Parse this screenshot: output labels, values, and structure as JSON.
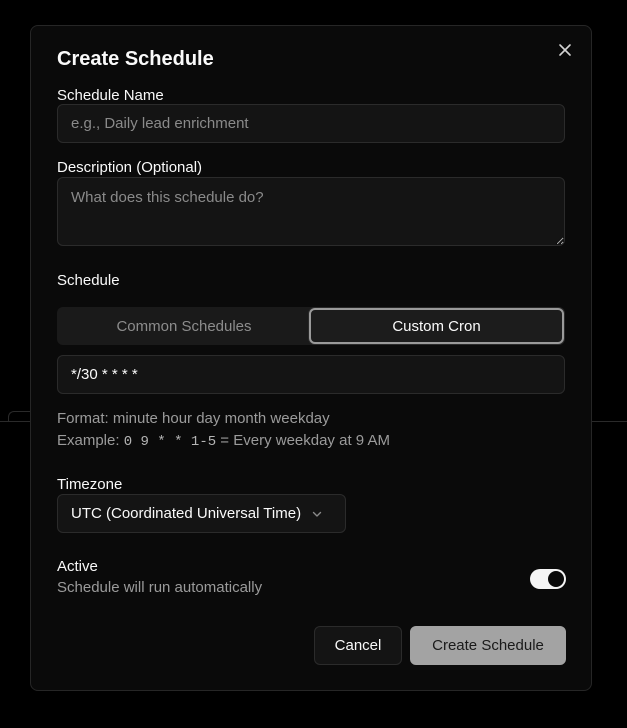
{
  "dialog": {
    "title": "Create Schedule"
  },
  "name_field": {
    "label": "Schedule Name",
    "value": "",
    "placeholder": "e.g., Daily lead enrichment"
  },
  "description_field": {
    "label": "Description (Optional)",
    "value": "",
    "placeholder": "What does this schedule do?"
  },
  "schedule": {
    "label": "Schedule",
    "tabs": [
      {
        "label": "Common Schedules",
        "active": false
      },
      {
        "label": "Custom Cron",
        "active": true
      }
    ],
    "cron_value": "*/30 * * * *",
    "format_text": "Format: minute hour day month weekday",
    "example_prefix": "Example:",
    "example_code": "0 9 * * 1-5",
    "example_suffix": "= Every weekday at 9 AM"
  },
  "timezone": {
    "label": "Timezone",
    "selected": "UTC (Coordinated Universal Time)"
  },
  "active": {
    "label": "Active",
    "description": "Schedule will run automatically",
    "enabled": true
  },
  "actions": {
    "cancel_label": "Cancel",
    "create_label": "Create Schedule"
  },
  "icons": {
    "close": "close-icon",
    "dropdown": "chevron-down-icon"
  },
  "colors": {
    "background": "#000000",
    "dialog": "#0a0a0a",
    "input": "#141414",
    "primary_button": "#a3a3a3",
    "muted_text": "#9b9b9b"
  }
}
